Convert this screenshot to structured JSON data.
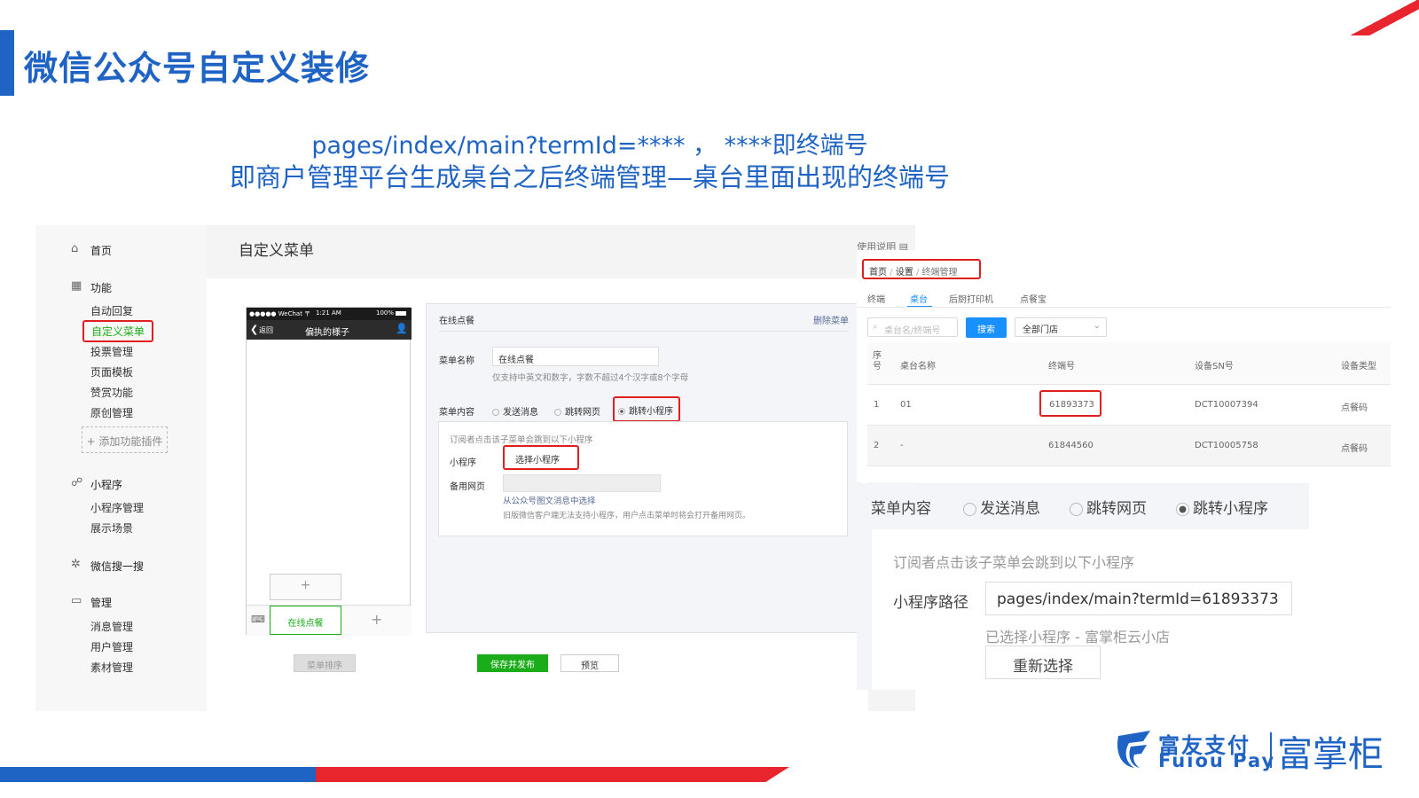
{
  "slide": {
    "title": "微信公众号自定义装修",
    "subtitle_line1": "pages/index/main?termId=****    ，   ****即终端号",
    "subtitle_line2": "即商户管理平台生成桌台之后终端管理—桌台里面出现的终端号"
  },
  "wechat_admin": {
    "sidebar": {
      "home": "首页",
      "func_header": "功能",
      "func_items": [
        "自动回复",
        "自定义菜单",
        "投票管理",
        "页面模板",
        "赞赏功能",
        "原创管理"
      ],
      "add_plugin": "+ 添加功能插件",
      "mini_header": "小程序",
      "mini_items": [
        "小程序管理",
        "展示场景"
      ],
      "search_header": "微信搜一搜",
      "manage_header": "管理",
      "manage_items": [
        "消息管理",
        "用户管理",
        "素材管理"
      ]
    },
    "page_title": "自定义菜单",
    "help_link": "使用说明",
    "phone": {
      "status_carrier": "●●●●● WeChat 〒",
      "status_time": "1:21 AM",
      "status_battery": "100%",
      "back": "返回",
      "account_name": "偏执的様子",
      "menu_item": "在线点餐",
      "add_sub": "+",
      "add_menu": "+"
    },
    "editor": {
      "menu_title": "在线点餐",
      "delete_menu": "删除菜单",
      "name_label": "菜单名称",
      "name_value": "在线点餐",
      "name_hint": "仅支持中英文和数字，字数不超过4个汉字或8个字母",
      "content_label": "菜单内容",
      "options": [
        "发送消息",
        "跳转网页",
        "跳转小程序"
      ],
      "selected": "跳转小程序",
      "redirect_hint": "订阅者点击该子菜单会跳到以下小程序",
      "mini_label": "小程序",
      "choose_mini": "选择小程序",
      "backup_label": "备用网页",
      "backup_link": "从公众号图文消息中选择",
      "backup_hint": "旧版微信客户端无法支持小程序，用户点击菜单时将会打开备用网页。"
    },
    "buttons": {
      "sort": "菜单排序",
      "save_publish": "保存并发布",
      "preview": "预览"
    }
  },
  "merchant_platform": {
    "breadcrumb": [
      "首页",
      "设置",
      "终端管理"
    ],
    "tabs": [
      "终端",
      "桌台",
      "后厨打印机",
      "点餐宝"
    ],
    "active_tab": "桌台",
    "search_placeholder": "桌台名/终端号",
    "search_button": "搜索",
    "store_select": "全部门店",
    "table": {
      "headers": [
        "序号",
        "桌台名称",
        "终端号",
        "设备SN号",
        "设备类型"
      ],
      "rows": [
        [
          "1",
          "01",
          "61893373",
          "DCT10007394",
          "点餐码"
        ],
        [
          "2",
          "-",
          "61844560",
          "DCT10005758",
          "点餐码"
        ]
      ]
    }
  },
  "zoom_panel": {
    "content_label": "菜单内容",
    "options": [
      "发送消息",
      "跳转网页",
      "跳转小程序"
    ],
    "selected": "跳转小程序",
    "redirect_hint": "订阅者点击该子菜单会跳到以下小程序",
    "path_label": "小程序路径",
    "path_value": "pages/index/main?termId=61893373",
    "selected_mini": "已选择小程序 - 富掌柜云小店",
    "reselect": "重新选择"
  },
  "brand": {
    "name_cn": "富友支付",
    "name_en": "Fuiou Pay",
    "product": "富掌柜",
    "colors": {
      "primary": "#1f64c4",
      "accent": "#e8242c",
      "green": "#1aad19"
    }
  }
}
